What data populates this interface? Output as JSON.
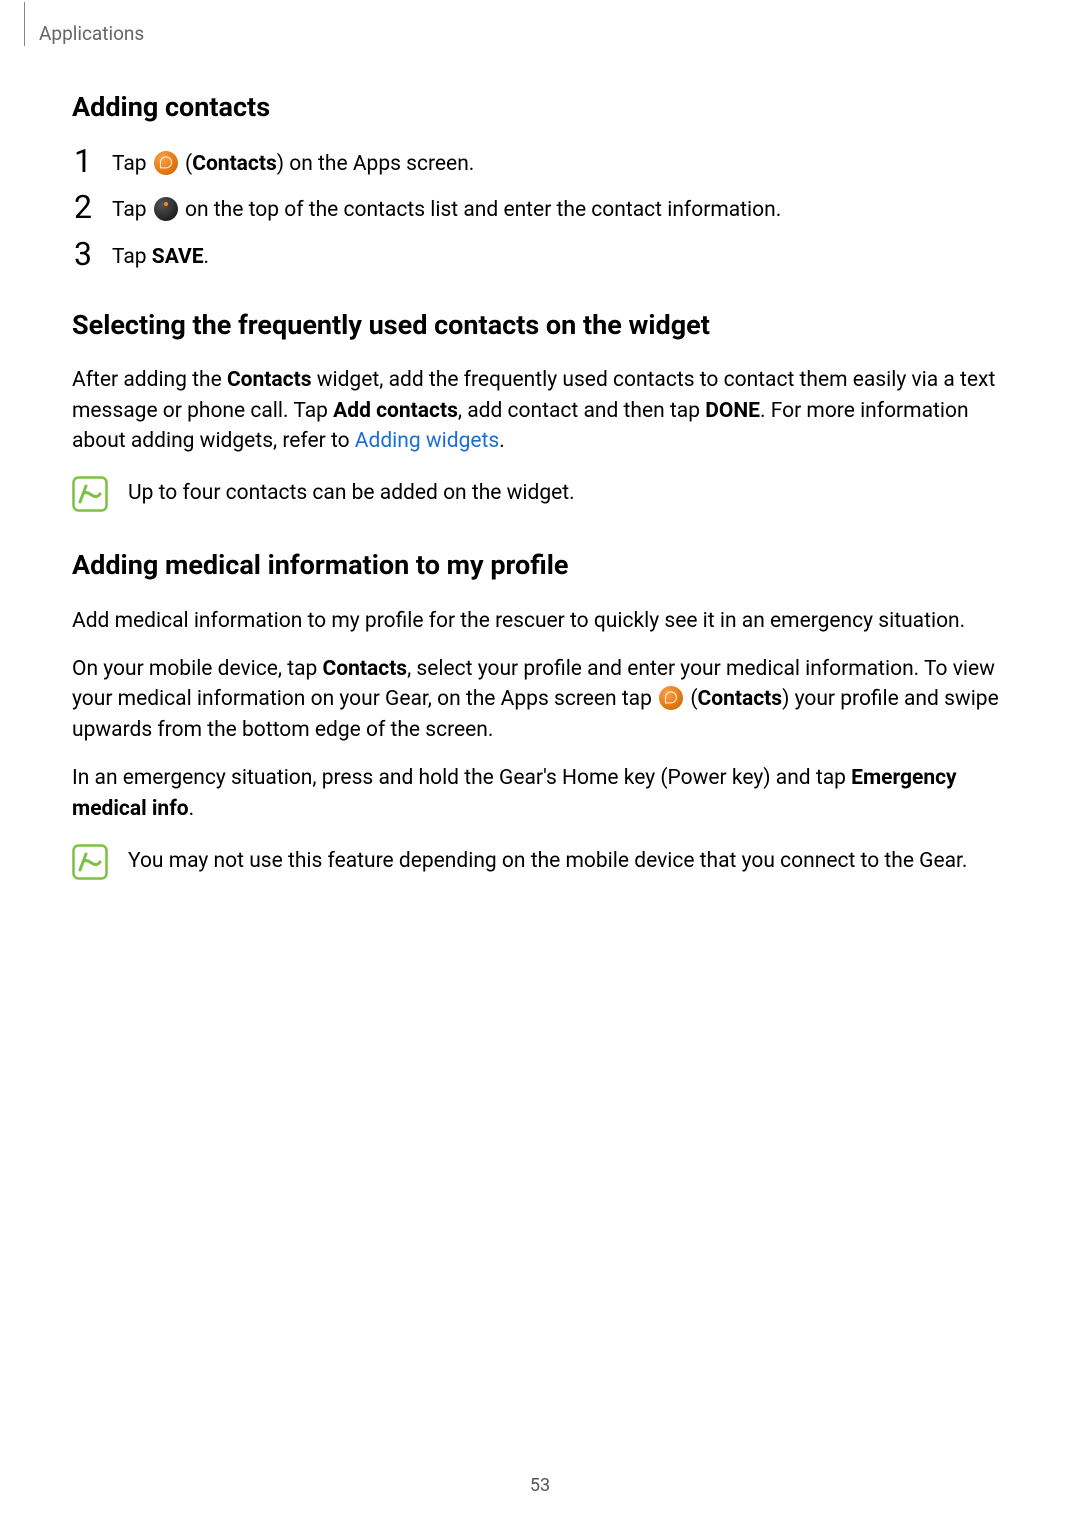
{
  "breadcrumb": "Applications",
  "page_number": "53",
  "sections": {
    "adding_contacts": {
      "heading": "Adding contacts",
      "step1_a": "Tap ",
      "step1_b": " (",
      "step1_bold": "Contacts",
      "step1_c": ") on the Apps screen.",
      "step2_a": "Tap ",
      "step2_b": " on the top of the contacts list and enter the contact information.",
      "step3_a": "Tap ",
      "step3_bold": "SAVE",
      "step3_b": ".",
      "nums": {
        "n1": "1",
        "n2": "2",
        "n3": "3"
      }
    },
    "selecting": {
      "heading": "Selecting the frequently used contacts on the widget",
      "para_a": "After adding the ",
      "para_bold1": "Contacts",
      "para_b": " widget, add the frequently used contacts to contact them easily via a text message or phone call. Tap ",
      "para_bold2": "Add contacts",
      "para_c": ", add contact and then tap ",
      "para_bold3": "DONE",
      "para_d": ". For more information about adding widgets, refer to ",
      "para_link": "Adding widgets",
      "para_e": ".",
      "note": "Up to four contacts can be added on the widget."
    },
    "medical": {
      "heading": "Adding medical information to my profile",
      "p1": "Add medical information to my profile for the rescuer to quickly see it in an emergency situation.",
      "p2_a": "On your mobile device, tap ",
      "p2_bold1": "Contacts",
      "p2_b": ", select your profile and enter your medical information. To view your medical information on your Gear, on the Apps screen tap ",
      "p2_c": " (",
      "p2_bold2": "Contacts",
      "p2_d": ")   your profile and swipe upwards from the bottom edge of the screen.",
      "p3_a": "In an emergency situation, press and hold the Gear's Home key (Power key) and tap ",
      "p3_bold": "Emergency medical info",
      "p3_b": ".",
      "note": "You may not use this feature depending on the mobile device that you connect to the Gear."
    }
  }
}
